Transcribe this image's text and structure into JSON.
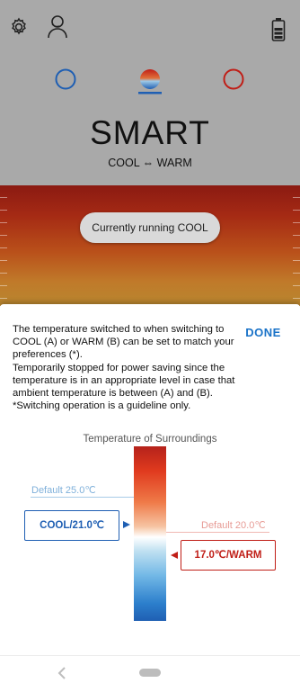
{
  "app": {
    "mode_title": "SMART",
    "mode_subtitle": "COOL ⇔ WARM",
    "status_pill": "Currently running COOL",
    "icons": {
      "settings": "gear-icon",
      "profile": "person-icon",
      "battery": "battery-icon",
      "cool_mode": "cool-mode-circle-icon",
      "smart_mode": "smart-mode-icon",
      "warm_mode": "warm-mode-circle-icon"
    },
    "colors": {
      "cool_ring": "#1f5fb3",
      "warm_ring": "#c01e17",
      "accent": "#1a73c8"
    }
  },
  "sheet": {
    "description": "The temperature switched to when switching to COOL (A) or WARM (B) can be set to match your preferences (*).\nTemporarily stopped for power saving since the temperature is in an appropriate level in case that ambient temperature is between (A) and (B).\n*Switching operation is a guideline only.",
    "done_label": "DONE",
    "surroundings_label": "Temperature of Surroundings",
    "cool_default": "Default 25.0℃",
    "warm_default": "Default 20.0℃",
    "cool_setting": "COOL/21.0℃",
    "warm_setting": "17.0℃/WARM"
  }
}
